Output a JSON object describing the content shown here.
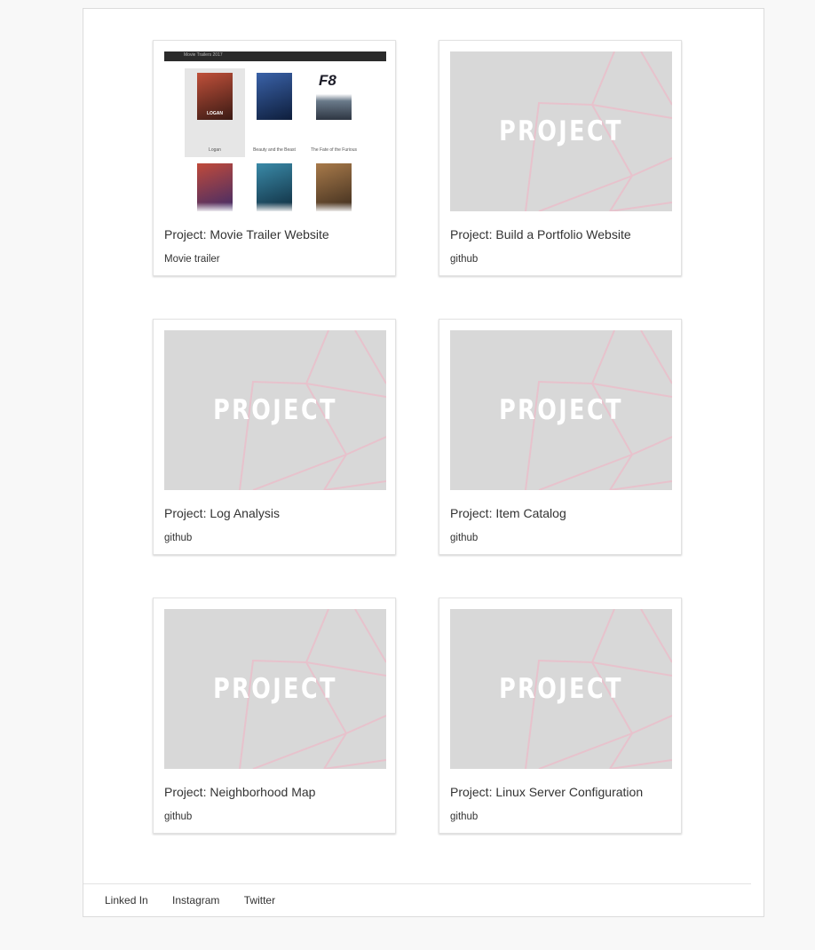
{
  "projects": [
    {
      "title": "Project: Movie Trailer Website",
      "link": "Movie trailer"
    },
    {
      "title": "Project: Build a Portfolio Website",
      "link": "github",
      "placeholder": "PROJECT"
    },
    {
      "title": "Project: Log Analysis",
      "link": "github",
      "placeholder": "PROJECT"
    },
    {
      "title": "Project: Item Catalog",
      "link": "github",
      "placeholder": "PROJECT"
    },
    {
      "title": "Project: Neighborhood Map",
      "link": "github",
      "placeholder": "PROJECT"
    },
    {
      "title": "Project: Linux Server Configuration",
      "link": "github",
      "placeholder": "PROJECT"
    }
  ],
  "movie_preview": {
    "header_text": "Movie Trailers 2017",
    "movies": [
      {
        "caption": "Logan",
        "color": "#b0402a"
      },
      {
        "caption": "Beauty and the Beast",
        "color": "#1f3f73"
      },
      {
        "caption": "The Fate of the Furious",
        "color": "#556070"
      },
      {
        "caption": "",
        "color": "#8a3048"
      },
      {
        "caption": "",
        "color": "#2d6a80"
      },
      {
        "caption": "",
        "color": "#7a5a3a"
      }
    ],
    "logan_label": "LOGAN",
    "f8_label": "F8"
  },
  "footer": {
    "links": [
      "Linked In",
      "Instagram",
      "Twitter"
    ]
  }
}
